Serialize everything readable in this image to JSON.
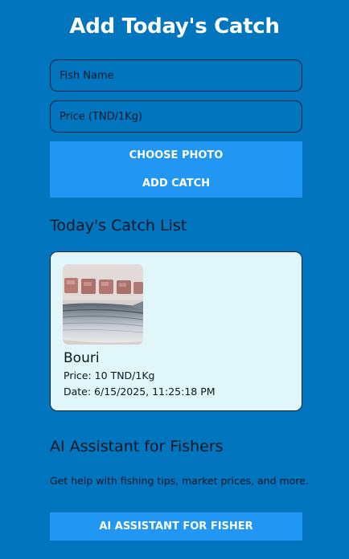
{
  "header": {
    "title": "Add Today's Catch"
  },
  "form": {
    "fish_name_placeholder": "Fish Name",
    "price_placeholder": "Price (TND/1Kg)",
    "choose_photo_label": "CHOOSE PHOTO",
    "add_catch_label": "ADD CATCH"
  },
  "catch_list": {
    "title": "Today's Catch List",
    "items": [
      {
        "name": "Bouri",
        "price": "Price: 10 TND/1Kg",
        "date": "Date: 6/15/2025, 11:25:18 PM"
      }
    ]
  },
  "assistant": {
    "title": "AI Assistant for Fishers",
    "description": "Get help with fishing tips, market prices, and more.",
    "button_label": "AI ASSISTANT FOR FISHER"
  },
  "colors": {
    "background": "#0175bd",
    "button": "#2196f3",
    "card": "#e1f6f9",
    "title_text": "#ffffff"
  }
}
